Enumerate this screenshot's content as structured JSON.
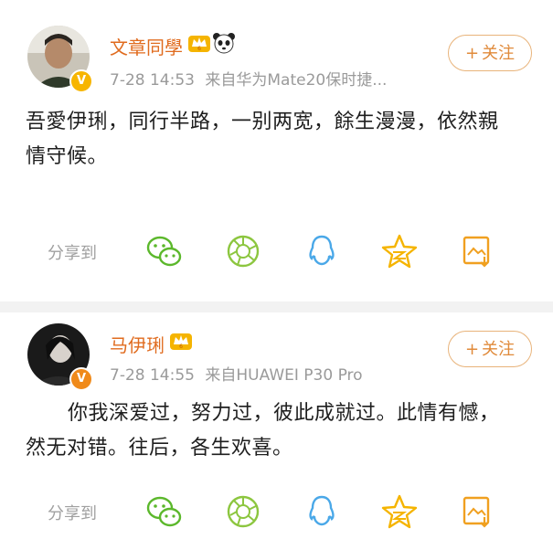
{
  "posts": [
    {
      "username": "文章同學",
      "time": "7-28 14:53",
      "source": "来自华为Mate20保时捷...",
      "follow_label": "关注",
      "follow_plus": "+",
      "text_lines": [
        "吾愛伊琍，同行半路，一别两宽，餘生漫漫，依然親",
        "情守候。"
      ],
      "share_label": "分享到"
    },
    {
      "username": "马伊琍",
      "time": "7-28 14:55",
      "source": "来自HUAWEI P30 Pro",
      "follow_label": "关注",
      "follow_plus": "+",
      "text_lines": [
        "你我深爱过，努力过，彼此成就过。此情有憾，",
        "然无对错。往后，各生欢喜。"
      ],
      "share_label": "分享到"
    }
  ],
  "icons": {
    "verified": "V",
    "wechat": "wechat-icon",
    "moments": "moments-icon",
    "qq": "qq-icon",
    "qzone": "qzone-star-icon",
    "save_image": "save-image-icon"
  },
  "colors": {
    "name": "#e06b1e",
    "accent": "#e08a3a",
    "wechat": "#5cb82c",
    "moments": "#8cc63f",
    "qq": "#4aa8e8",
    "qzone": "#f5b400",
    "save": "#f0a020"
  }
}
